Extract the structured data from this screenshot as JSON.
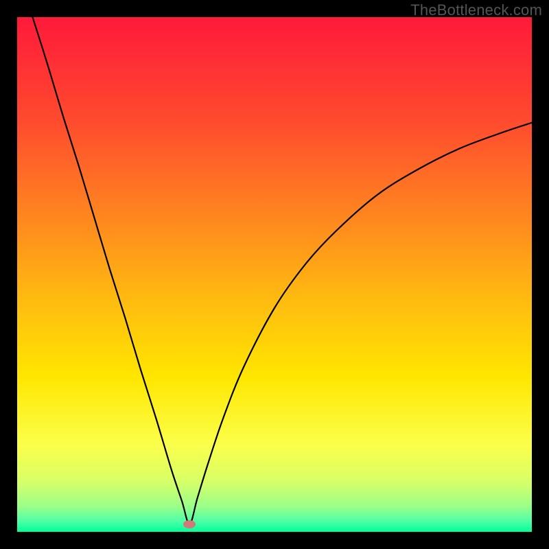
{
  "watermark": "TheBottleneck.com",
  "gradient_stops": [
    {
      "offset": 0.0,
      "color": "#ff1a3a"
    },
    {
      "offset": 0.2,
      "color": "#ff4a2e"
    },
    {
      "offset": 0.4,
      "color": "#ff8a1e"
    },
    {
      "offset": 0.55,
      "color": "#ffbb10"
    },
    {
      "offset": 0.7,
      "color": "#ffe600"
    },
    {
      "offset": 0.83,
      "color": "#fbff4a"
    },
    {
      "offset": 0.9,
      "color": "#d9ff66"
    },
    {
      "offset": 0.95,
      "color": "#9cff88"
    },
    {
      "offset": 0.98,
      "color": "#4cffa7"
    },
    {
      "offset": 1.0,
      "color": "#00ff99"
    }
  ],
  "chart_data": {
    "type": "line",
    "title": "",
    "xlabel": "",
    "ylabel": "",
    "xlim": [
      0,
      1
    ],
    "ylim": [
      0,
      1
    ],
    "minimum": {
      "x": 0.335,
      "y": 0.985
    },
    "marker_color": "#cf7a7a",
    "series": [
      {
        "name": "curve",
        "color": "#000000",
        "x": [
          0.03,
          0.06,
          0.09,
          0.12,
          0.15,
          0.18,
          0.21,
          0.24,
          0.27,
          0.3,
          0.32,
          0.335,
          0.35,
          0.37,
          0.4,
          0.44,
          0.5,
          0.56,
          0.62,
          0.7,
          0.78,
          0.86,
          0.94,
          1.0
        ],
        "y": [
          0.0,
          0.095,
          0.195,
          0.29,
          0.39,
          0.49,
          0.585,
          0.685,
          0.78,
          0.88,
          0.94,
          0.985,
          0.935,
          0.87,
          0.78,
          0.68,
          0.565,
          0.48,
          0.415,
          0.345,
          0.295,
          0.255,
          0.225,
          0.205
        ]
      }
    ]
  }
}
